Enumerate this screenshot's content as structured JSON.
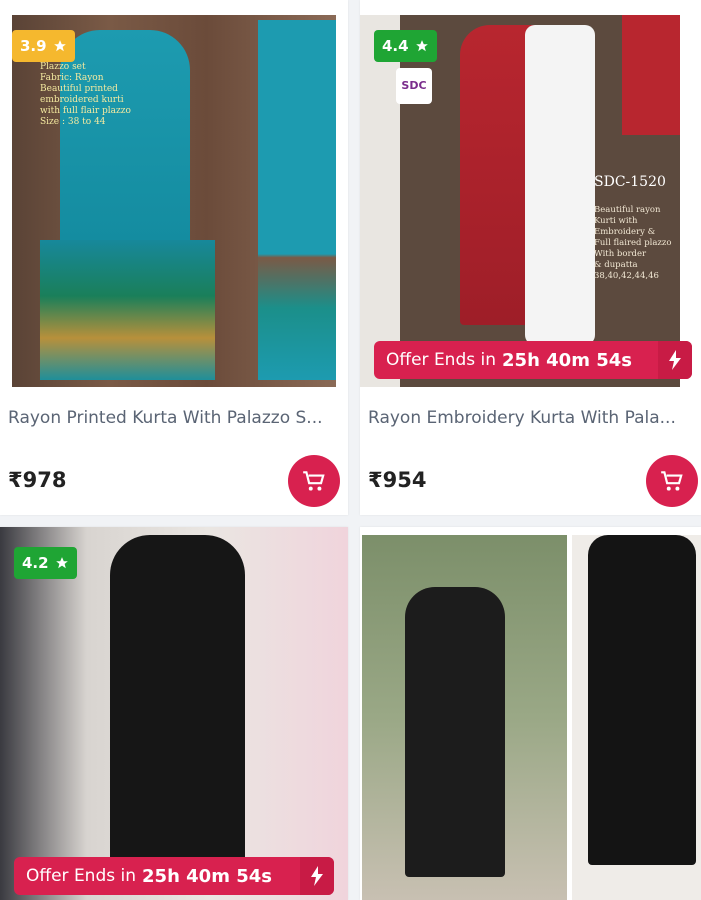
{
  "colors": {
    "accent": "#d8214f",
    "rating_yellow": "#f5b82e",
    "rating_green": "#1fa534"
  },
  "products": [
    {
      "rating": "3.9",
      "rating_color": "#f5b82e",
      "title": "Rayon Printed Kurta With Palazzo S...",
      "price": "₹978",
      "overlay_text": "Plazzo set\nFabric: Rayon\nBeautiful printed\nembroidered kurti\nwith full flair plazzo\nSize : 38 to 44"
    },
    {
      "rating": "4.4",
      "rating_color": "#1fa534",
      "title": "Rayon Embroidery Kurta With Pala...",
      "price": "₹954",
      "brand_logo": "SDC",
      "code": "SDC-1520",
      "overlay_text": "Beautiful rayon\nKurti with\nEmbroidery &\nFull flaired plazzo\nWith border\n& dupatta\n38,40,42,44,46",
      "offer_label": "Offer Ends in",
      "offer_time": "25h 40m 54s"
    },
    {
      "rating": "4.2",
      "rating_color": "#1fa534",
      "offer_label": "Offer Ends in",
      "offer_time": "25h 40m 54s"
    },
    {}
  ]
}
